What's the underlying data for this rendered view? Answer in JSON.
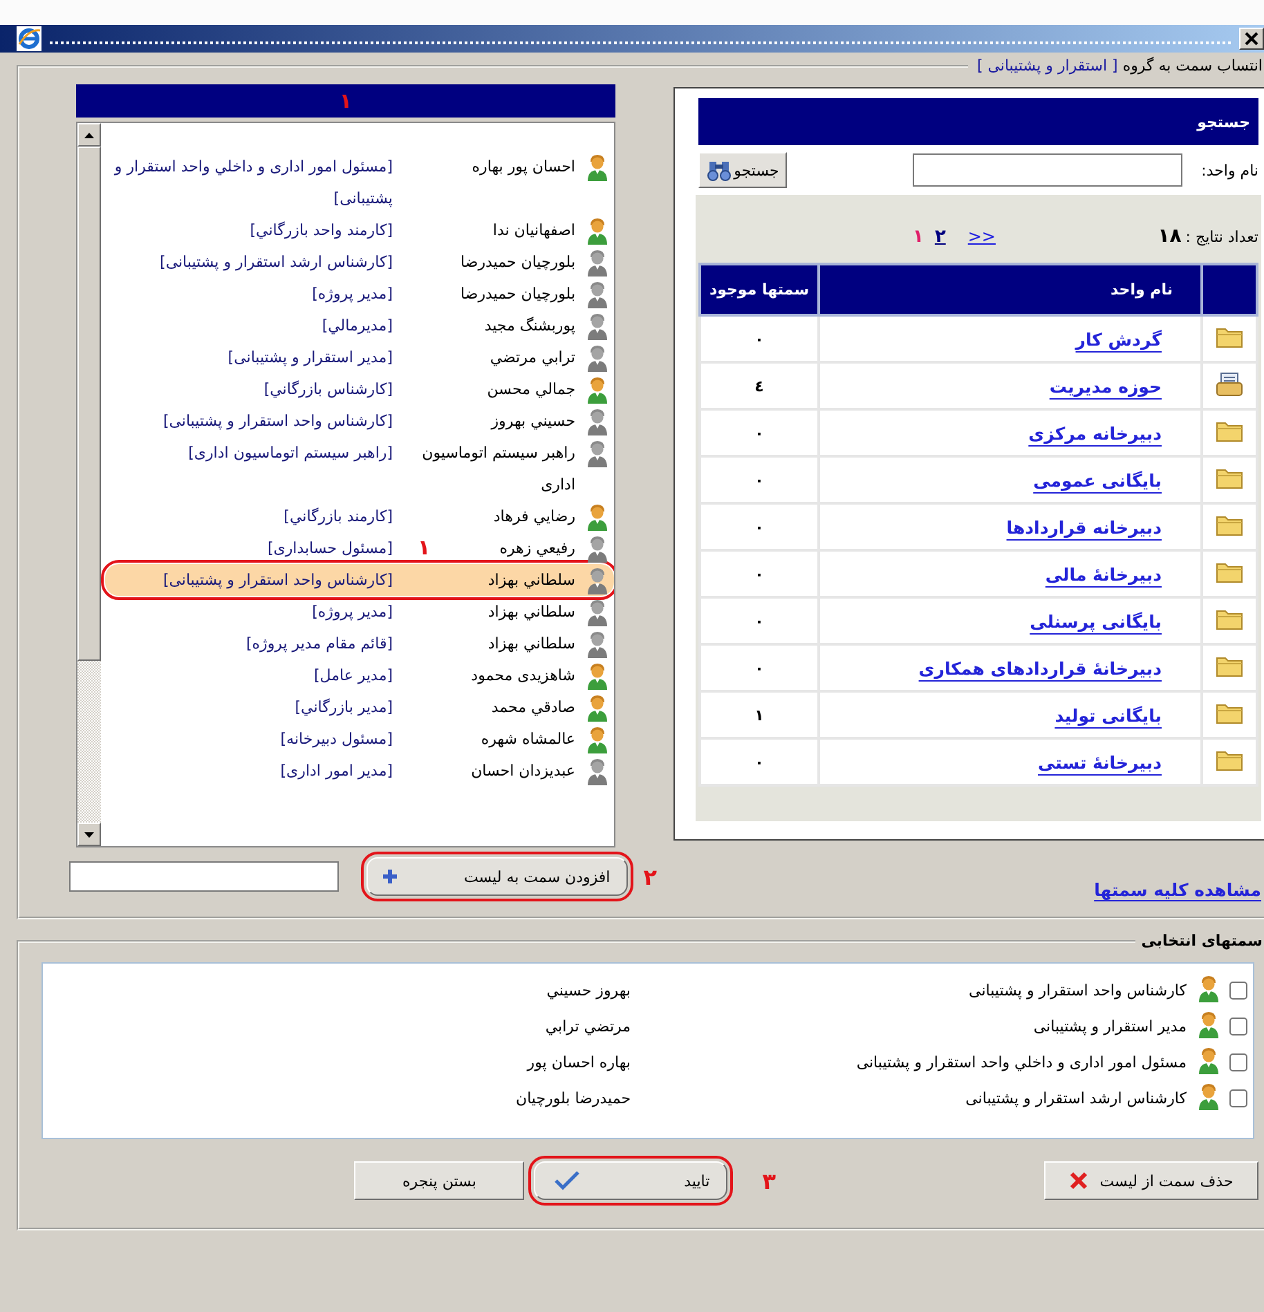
{
  "assignment": {
    "label": "انتساب سمت به گروه",
    "group": "[ استقرار و پشتیبانی ]"
  },
  "positions_list": {
    "header_mark": "۱",
    "items": [
      {
        "name": "احسان پور بهاره",
        "position": "[مسئول امور اداری و داخلي واحد استقرار و پشتیبانی]",
        "active": true,
        "selected": false
      },
      {
        "name": "اصفهانیان ندا",
        "position": "[کارمند واحد بازرگاني]",
        "active": true,
        "selected": false
      },
      {
        "name": "بلورچیان حمیدرضا",
        "position": "[کارشناس ارشد استقرار و پشتیبانی]",
        "active": false,
        "selected": false
      },
      {
        "name": "بلورچیان حمیدرضا",
        "position": "[مدیر پروژه]",
        "active": false,
        "selected": false
      },
      {
        "name": "پوربشنگ مجید",
        "position": "[مديرمالي]",
        "active": false,
        "selected": false
      },
      {
        "name": "ترابي مرتضي",
        "position": "[مدیر استقرار و پشتیبانی]",
        "active": false,
        "selected": false
      },
      {
        "name": "جمالي محسن",
        "position": "[کارشناس بازرگاني]",
        "active": true,
        "selected": false
      },
      {
        "name": "حسيني بهروز",
        "position": "[کارشناس واحد استقرار و پشتیبانی]",
        "active": false,
        "selected": false
      },
      {
        "name": "راهبر سیستم اتوماسیون اداری",
        "position": "[راهبر سیستم اتوماسیون اداری]",
        "active": false,
        "selected": false
      },
      {
        "name": "رضايي فرهاد",
        "position": "[کارمند بازرگاني]",
        "active": true,
        "selected": false
      },
      {
        "name": "رفيعي زهره",
        "position": "[مسئول حسابداری]",
        "active": false,
        "selected": false,
        "annotation": "۱"
      },
      {
        "name": "سلطاني بهزاد",
        "position": "[کارشناس واحد استقرار و پشتیبانی]",
        "active": false,
        "selected": true
      },
      {
        "name": "سلطاني بهزاد",
        "position": "[مدیر پروژه]",
        "active": false,
        "selected": false
      },
      {
        "name": "سلطاني بهزاد",
        "position": "[قائم مقام مدیر پروژه]",
        "active": false,
        "selected": false
      },
      {
        "name": "شاهزیدی محمود",
        "position": "[مدیر عامل]",
        "active": true,
        "selected": false
      },
      {
        "name": "صادقي محمد",
        "position": "[مدیر بازرگاني]",
        "active": true,
        "selected": false
      },
      {
        "name": "عالمشاه شهره",
        "position": "[مسئول دبیرخانه]",
        "active": true,
        "selected": false
      },
      {
        "name": "عبدیزدان احسان",
        "position": "[مدیر امور اداری]",
        "active": false,
        "selected": false
      }
    ]
  },
  "unit_search": {
    "title": "جستجو",
    "field_label": "نام واحد:",
    "search_button": "جستجو",
    "result_count_label": "تعداد نتایج :",
    "result_count": "۱۸",
    "next_page": ">>",
    "pages": [
      {
        "label": "۲",
        "selected": false
      },
      {
        "label": "۱",
        "selected": true
      }
    ],
    "table": {
      "columns": [
        "نام واحد",
        "سمتها موجود"
      ],
      "rows": [
        {
          "kind": "folder",
          "name": "گردش کار",
          "count": "۰"
        },
        {
          "kind": "document",
          "name": "حوزه مدیریت",
          "count": "٤"
        },
        {
          "kind": "folder",
          "name": "دبیرخانه مرکزی",
          "count": "۰"
        },
        {
          "kind": "folder",
          "name": "بایگانی عمومی",
          "count": "۰"
        },
        {
          "kind": "folder",
          "name": "دبیرخانه قراردادها",
          "count": "۰"
        },
        {
          "kind": "folder",
          "name": "دبیرخانهٔ مالی",
          "count": "۰"
        },
        {
          "kind": "folder",
          "name": "بایگانی پرسنلی",
          "count": "۰"
        },
        {
          "kind": "folder",
          "name": "دبیرخانهٔ قراردادهای همکاری",
          "count": "۰"
        },
        {
          "kind": "folder",
          "name": "بایگانی تولید",
          "count": "۱"
        },
        {
          "kind": "folder",
          "name": "دبیرخانهٔ تستی",
          "count": "۰"
        }
      ]
    }
  },
  "view_all_link": "مشاهده کلیه سمتها",
  "add_button": {
    "label": "افزودن سمت به لیست",
    "circled": true,
    "mark": "۲"
  },
  "selected_positions": {
    "title": "سمتهای انتخابی",
    "items": [
      {
        "checked": false,
        "position": "کارشناس واحد استقرار و پشتیبانی",
        "person": "بهروز حسيني"
      },
      {
        "checked": false,
        "position": "مدیر استقرار و پشتیبانی",
        "person": "مرتضي ترابي"
      },
      {
        "checked": false,
        "position": "مسئول امور اداری و داخلي واحد استقرار و پشتیبانی",
        "person": "بهاره احسان پور"
      },
      {
        "checked": false,
        "position": "کارشناس ارشد استقرار و پشتیبانی",
        "person": "حمیدرضا بلورچیان"
      }
    ]
  },
  "buttons": {
    "delete": {
      "label": "حذف سمت از لیست",
      "circled": false
    },
    "confirm": {
      "label": "تایید",
      "circled": true,
      "mark": "۳"
    },
    "close": {
      "label": "بستن پنجره",
      "circled": false
    }
  }
}
